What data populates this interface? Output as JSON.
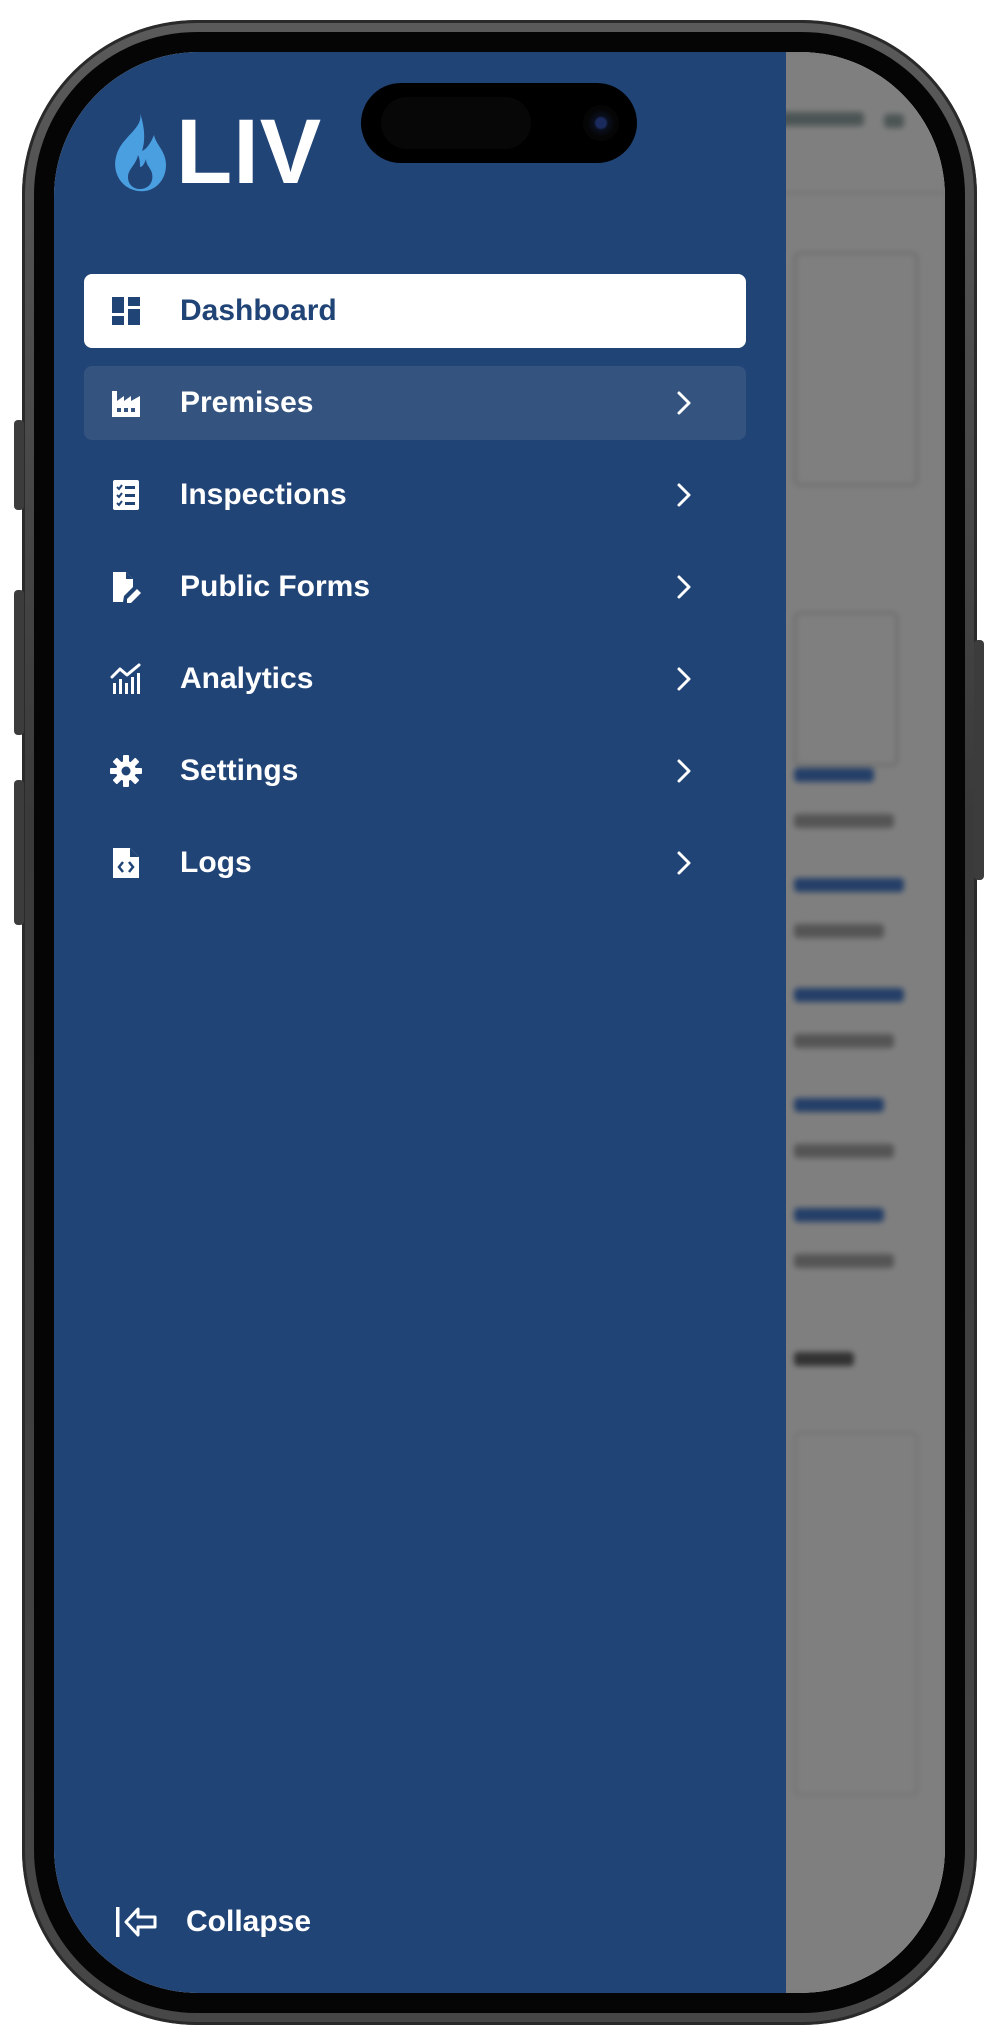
{
  "brand": {
    "name": "LIV",
    "flame_color": "#4a9fe0"
  },
  "colors": {
    "drawer_bg": "#214477",
    "active_item_bg": "#ffffff",
    "active_item_text": "#214477",
    "hover_item_bg": "#34547f"
  },
  "sidebar": {
    "items": [
      {
        "label": "Dashboard",
        "icon": "dashboard-icon",
        "active": true,
        "has_submenu": false
      },
      {
        "label": "Premises",
        "icon": "factory-icon",
        "active": false,
        "has_submenu": true
      },
      {
        "label": "Inspections",
        "icon": "checklist-icon",
        "active": false,
        "has_submenu": true
      },
      {
        "label": "Public Forms",
        "icon": "file-edit-icon",
        "active": false,
        "has_submenu": true
      },
      {
        "label": "Analytics",
        "icon": "chart-icon",
        "active": false,
        "has_submenu": true
      },
      {
        "label": "Settings",
        "icon": "gear-icon",
        "active": false,
        "has_submenu": true
      },
      {
        "label": "Logs",
        "icon": "file-code-icon",
        "active": false,
        "has_submenu": true
      }
    ],
    "collapse_label": "Collapse"
  }
}
